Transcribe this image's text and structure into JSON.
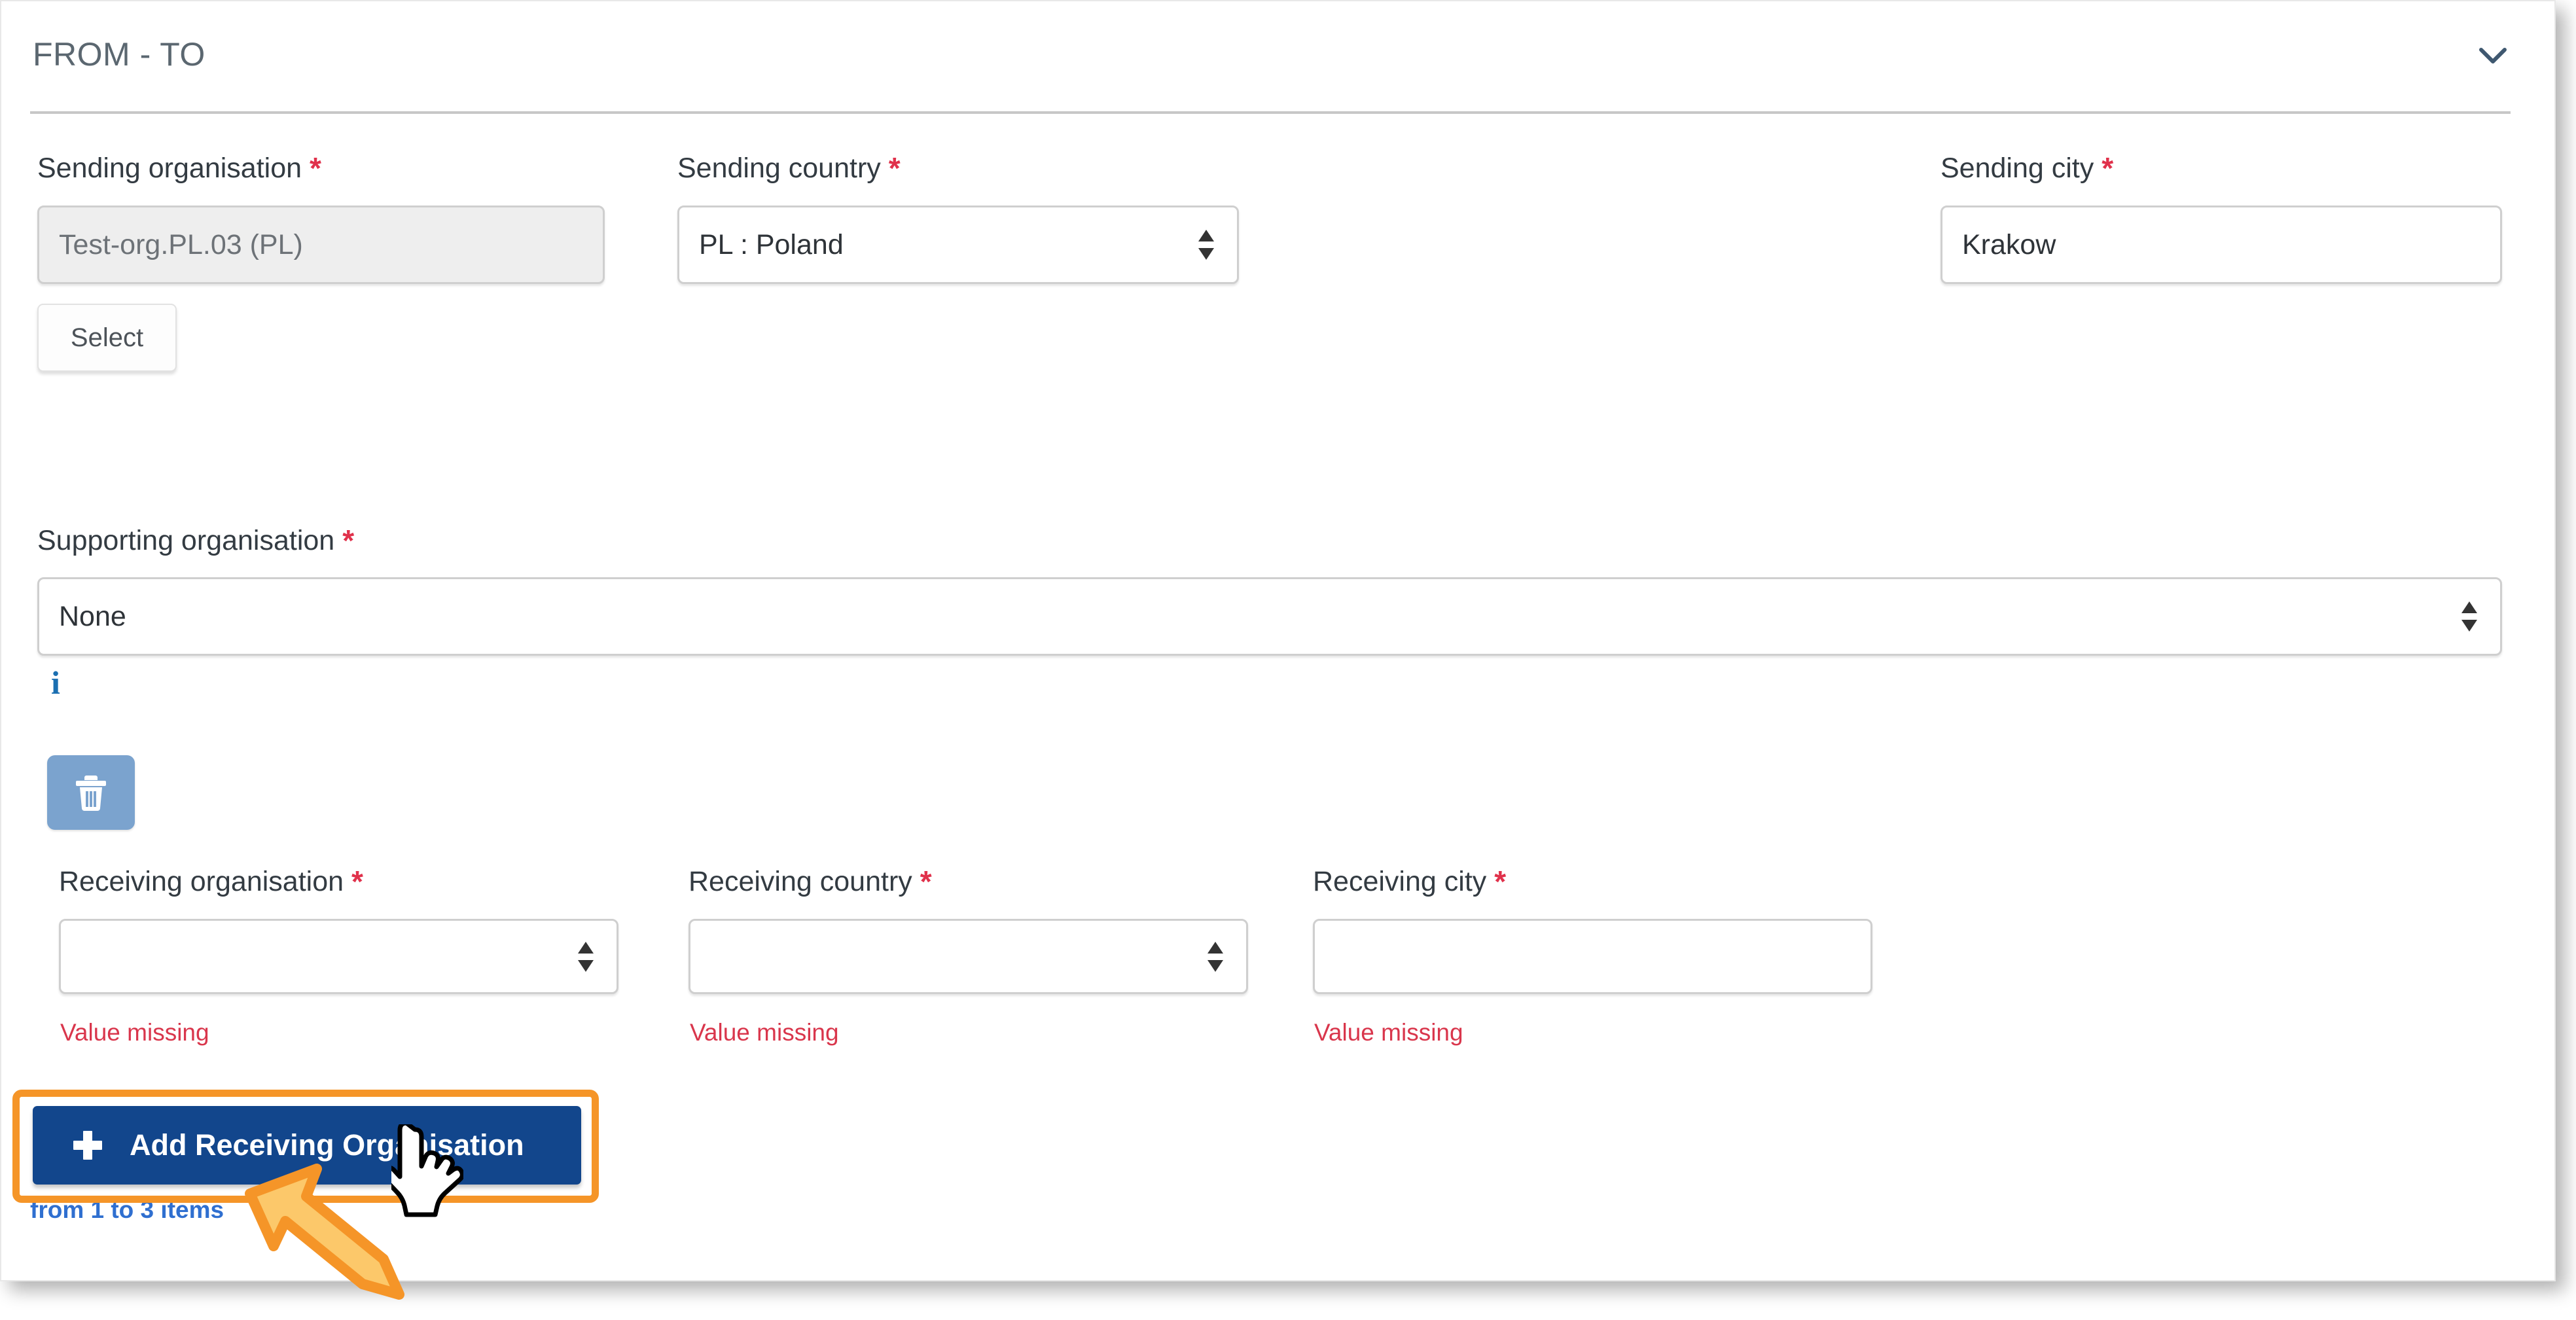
{
  "panel": {
    "title": "FROM - TO",
    "collapse_icon": "chevron-down-icon"
  },
  "required_marker": "*",
  "sending": {
    "organisation": {
      "label": "Sending organisation",
      "value": "Test-org.PL.03 (PL)",
      "readonly": true,
      "select_button_label": "Select"
    },
    "country": {
      "label": "Sending country",
      "value": "PL : Poland"
    },
    "city": {
      "label": "Sending city",
      "value": "Krakow"
    }
  },
  "supporting": {
    "label": "Supporting organisation",
    "value": "None",
    "info_icon": "info-icon",
    "info_glyph": "i"
  },
  "receiving_row": {
    "delete_icon": "trash-icon",
    "organisation": {
      "label": "Receiving organisation",
      "value": "",
      "error": "Value missing"
    },
    "country": {
      "label": "Receiving country",
      "value": "",
      "error": "Value missing"
    },
    "city": {
      "label": "Receiving city",
      "value": "",
      "error": "Value missing"
    }
  },
  "add_action": {
    "plus_icon": "plus-icon",
    "label": "Add Receiving Organisation",
    "hint": "from 1 to 3 items"
  },
  "annotation": {
    "arrow_icon": "arrow-up-left-icon",
    "cursor_icon": "pointing-hand-cursor",
    "highlight_color": "#f59528"
  },
  "colors": {
    "primary_button": "#12468c",
    "delete_button": "#7ba3ce",
    "required_star": "#e0314b",
    "error_text": "#d9364c",
    "hint_link": "#2f6fd0",
    "info_icon": "#1b6fb1"
  }
}
